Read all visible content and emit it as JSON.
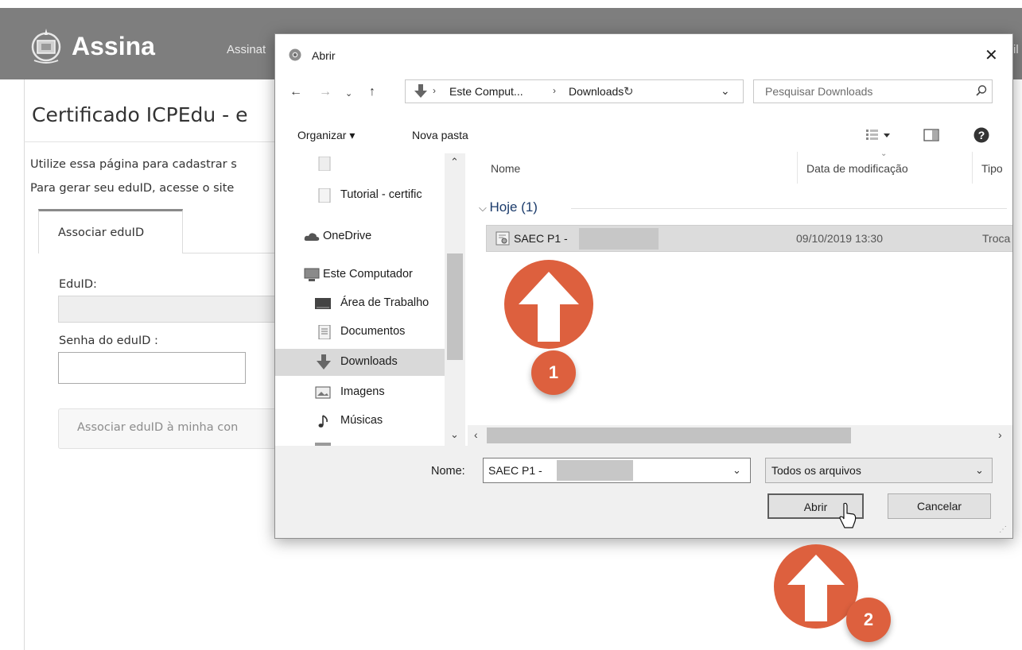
{
  "page": {
    "logo_text": "Assina",
    "nav_link": "Assinat",
    "nav_right": "il",
    "title": "Certificado ICPEdu - e",
    "intro_line1": "Utilize essa página para cadastrar s",
    "intro_line2": "Para gerar seu eduID, acesse o site",
    "tab_label": "Associar eduID",
    "eduid_label": "EduID:",
    "password_label": "Senha do eduID :",
    "associate_button": "Associar eduID à minha con"
  },
  "dialog": {
    "title": "Abrir",
    "address": {
      "crumbs": [
        "Este Comput...",
        "Downloads"
      ]
    },
    "search_placeholder": "Pesquisar Downloads",
    "toolbar": {
      "organize": "Organizar ▾",
      "new_folder": "Nova pasta"
    },
    "nav_pane": [
      {
        "label": "Tutorial - certific",
        "icon": "file-icon"
      },
      {
        "label": "OneDrive",
        "icon": "cloud-icon"
      },
      {
        "label": "Este Computador",
        "icon": "computer-icon"
      },
      {
        "label": "Área de Trabalho",
        "icon": "desktop-icon"
      },
      {
        "label": "Documentos",
        "icon": "documents-icon"
      },
      {
        "label": "Downloads",
        "icon": "download-icon",
        "selected": true
      },
      {
        "label": "Imagens",
        "icon": "pictures-icon"
      },
      {
        "label": "Músicas",
        "icon": "music-icon"
      }
    ],
    "columns": {
      "name": "Nome",
      "modified": "Data de modificação",
      "type": "Tipo"
    },
    "group": "Hoje (1)",
    "files": [
      {
        "name": "SAEC P1 -",
        "modified": "09/10/2019 13:30",
        "type": "Troca"
      }
    ],
    "filename_label": "Nome:",
    "filename_value": "SAEC P1 -",
    "filter_value": "Todos os arquivos",
    "open_button": "Abrir",
    "cancel_button": "Cancelar"
  },
  "annotations": {
    "step1": "1",
    "step2": "2",
    "color": "#dd603e"
  }
}
